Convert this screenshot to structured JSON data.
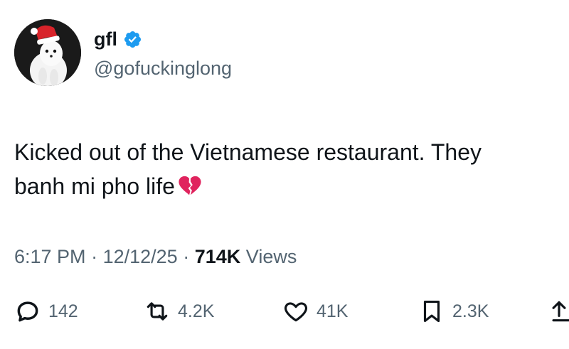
{
  "author": {
    "display_name": "gfl",
    "handle": "@gofuckinglong",
    "verified": true,
    "avatar_icon": "white-ermine-santa-hat-avatar",
    "verified_icon": "verified-badge-icon",
    "verified_color": "#1d9bf0"
  },
  "tweet": {
    "line1": "Kicked out of the Vietnamese restaurant. They",
    "line2": "banh mi pho life",
    "emoji": "broken-heart-emoji"
  },
  "meta": {
    "time": "6:17 PM",
    "separator": "·",
    "date": "12/12/25",
    "views_count": "714K",
    "views_label": "Views"
  },
  "actions": {
    "replies": "142",
    "reposts": "4.2K",
    "likes": "41K",
    "bookmarks": "2.3K",
    "icons": [
      "reply-icon",
      "repost-icon",
      "like-icon",
      "bookmark-icon",
      "share-icon"
    ]
  },
  "colors": {
    "text": "#0f1419",
    "secondary": "#536471",
    "broken_heart": "#e0245e"
  }
}
